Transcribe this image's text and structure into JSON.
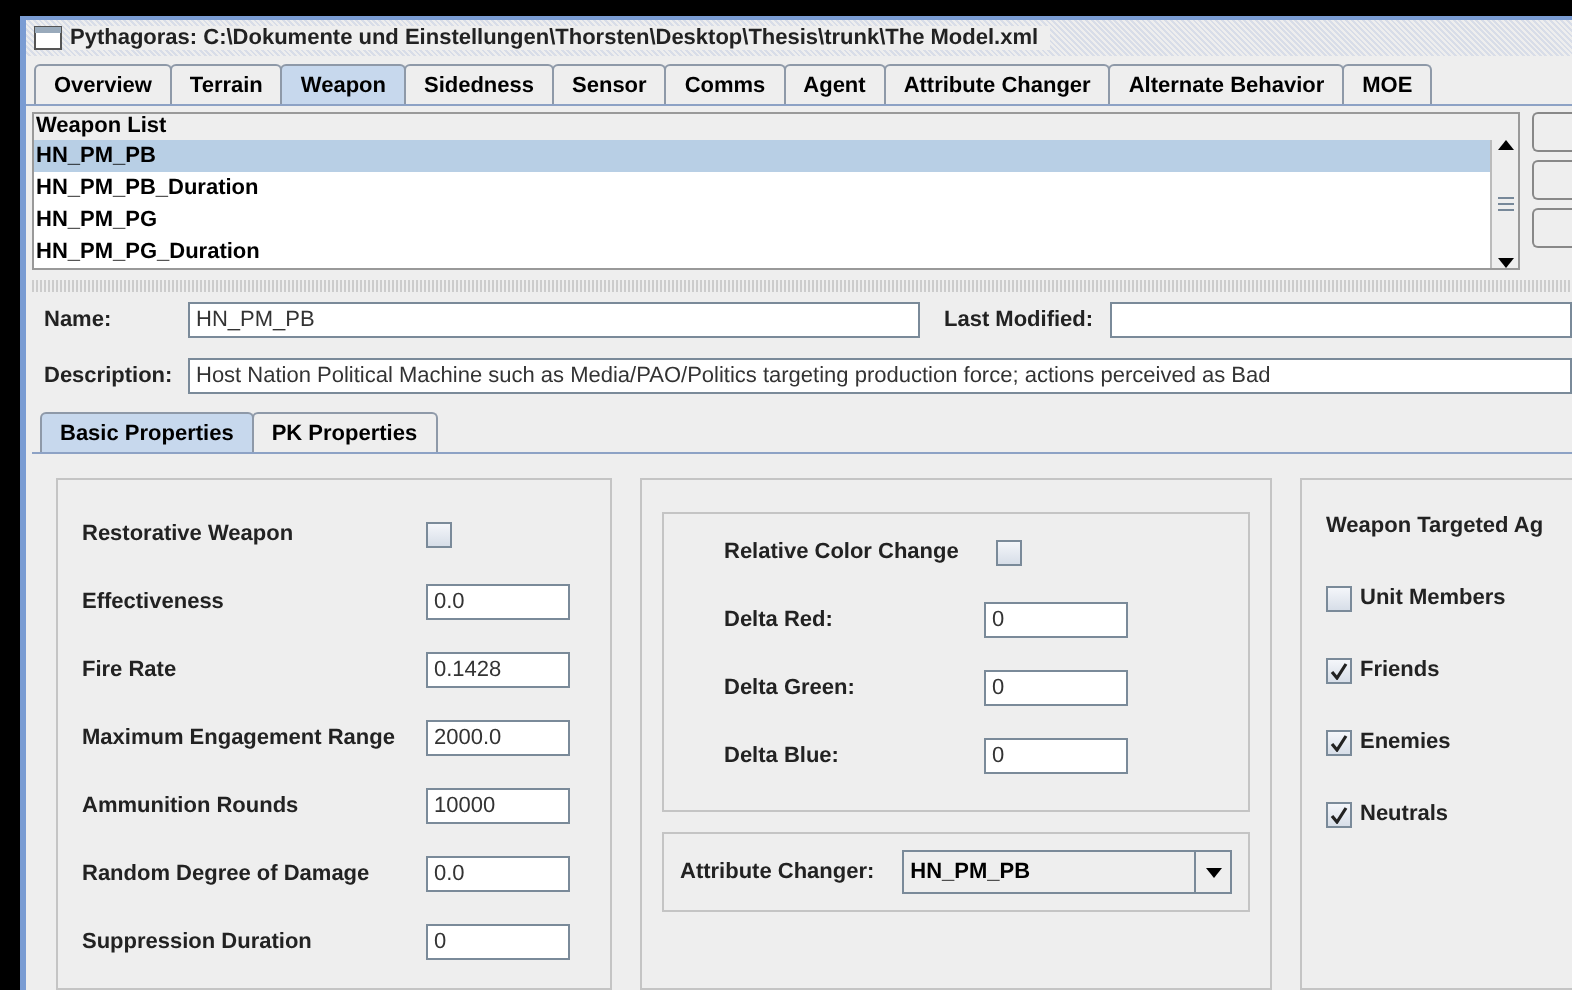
{
  "window": {
    "title": "Pythagoras: C:\\Dokumente und Einstellungen\\Thorsten\\Desktop\\Thesis\\trunk\\The Model.xml"
  },
  "tabs": [
    {
      "label": "Overview",
      "selected": false
    },
    {
      "label": "Terrain",
      "selected": false
    },
    {
      "label": "Weapon",
      "selected": true
    },
    {
      "label": "Sidedness",
      "selected": false
    },
    {
      "label": "Sensor",
      "selected": false
    },
    {
      "label": "Comms",
      "selected": false
    },
    {
      "label": "Agent",
      "selected": false
    },
    {
      "label": "Attribute Changer",
      "selected": false
    },
    {
      "label": "Alternate Behavior",
      "selected": false
    },
    {
      "label": "MOE",
      "selected": false
    }
  ],
  "weapon_list": {
    "title": "Weapon List",
    "items": [
      {
        "label": "HN_PM_PB",
        "selected": true
      },
      {
        "label": "HN_PM_PB_Duration",
        "selected": false
      },
      {
        "label": "HN_PM_PG",
        "selected": false
      },
      {
        "label": "HN_PM_PG_Duration",
        "selected": false
      }
    ]
  },
  "name": {
    "label": "Name:",
    "value": "HN_PM_PB"
  },
  "last_modified": {
    "label": "Last Modified:"
  },
  "description": {
    "label": "Description:",
    "value": "Host Nation Political Machine such as Media/PAO/Politics targeting production force; actions perceived as Bad"
  },
  "subtabs": [
    {
      "label": "Basic Properties",
      "selected": true
    },
    {
      "label": "PK Properties",
      "selected": false
    }
  ],
  "basic": [
    {
      "kind": "checkbox",
      "label": "Restorative Weapon",
      "checked": false
    },
    {
      "kind": "field",
      "label": "Effectiveness",
      "value": "0.0"
    },
    {
      "kind": "field",
      "label": "Fire Rate",
      "value": "0.1428"
    },
    {
      "kind": "field",
      "label": "Maximum Engagement Range",
      "value": "2000.0"
    },
    {
      "kind": "field",
      "label": "Ammunition Rounds",
      "value": "10000"
    },
    {
      "kind": "field",
      "label": "Random Degree of Damage",
      "value": "0.0"
    },
    {
      "kind": "field",
      "label": "Suppression Duration",
      "value": "0"
    }
  ],
  "color_change": [
    {
      "kind": "checkbox",
      "label": "Relative Color Change",
      "checked": false
    },
    {
      "kind": "field",
      "label": "Delta Red:",
      "value": "0"
    },
    {
      "kind": "field",
      "label": "Delta Green:",
      "value": "0"
    },
    {
      "kind": "field",
      "label": "Delta Blue:",
      "value": "0"
    }
  ],
  "attribute_changer": {
    "label": "Attribute Changer:",
    "value": "HN_PM_PB"
  },
  "targeted": {
    "title": "Weapon Targeted Ag",
    "options": [
      {
        "label": "Unit Members",
        "checked": false
      },
      {
        "label": "Friends",
        "checked": true
      },
      {
        "label": "Enemies",
        "checked": true
      },
      {
        "label": "Neutrals",
        "checked": true
      }
    ]
  }
}
